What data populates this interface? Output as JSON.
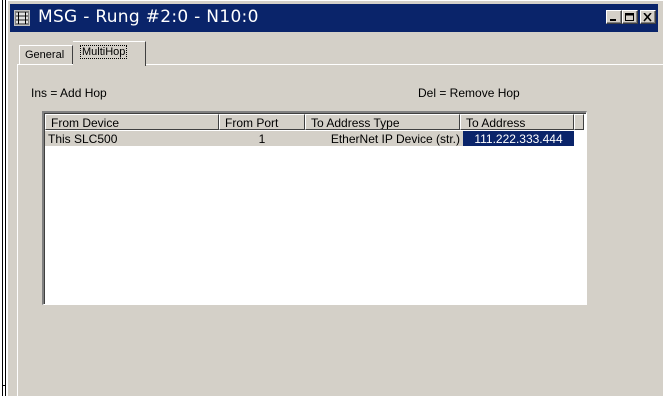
{
  "window": {
    "title": "MSG - Rung #2:0 - N10:0",
    "controls": [
      "minimize",
      "maximize",
      "close"
    ]
  },
  "tabs": [
    {
      "label": "General",
      "selected": false
    },
    {
      "label": "MultiHop",
      "selected": true
    }
  ],
  "hints": {
    "insert": "Ins = Add Hop",
    "delete": "Del = Remove Hop"
  },
  "hop_table": {
    "columns": [
      "From Device",
      "From Port",
      "To Address Type",
      "To Address"
    ],
    "rows": [
      {
        "from_device": "This SLC500",
        "from_port": "1",
        "to_address_type": "EtherNet IP Device (str.)",
        "to_address": "111.222.333.444"
      }
    ]
  },
  "colors": {
    "titlebar": "#0a246a",
    "face": "#d4d0c8",
    "selection": "#0a246a"
  }
}
